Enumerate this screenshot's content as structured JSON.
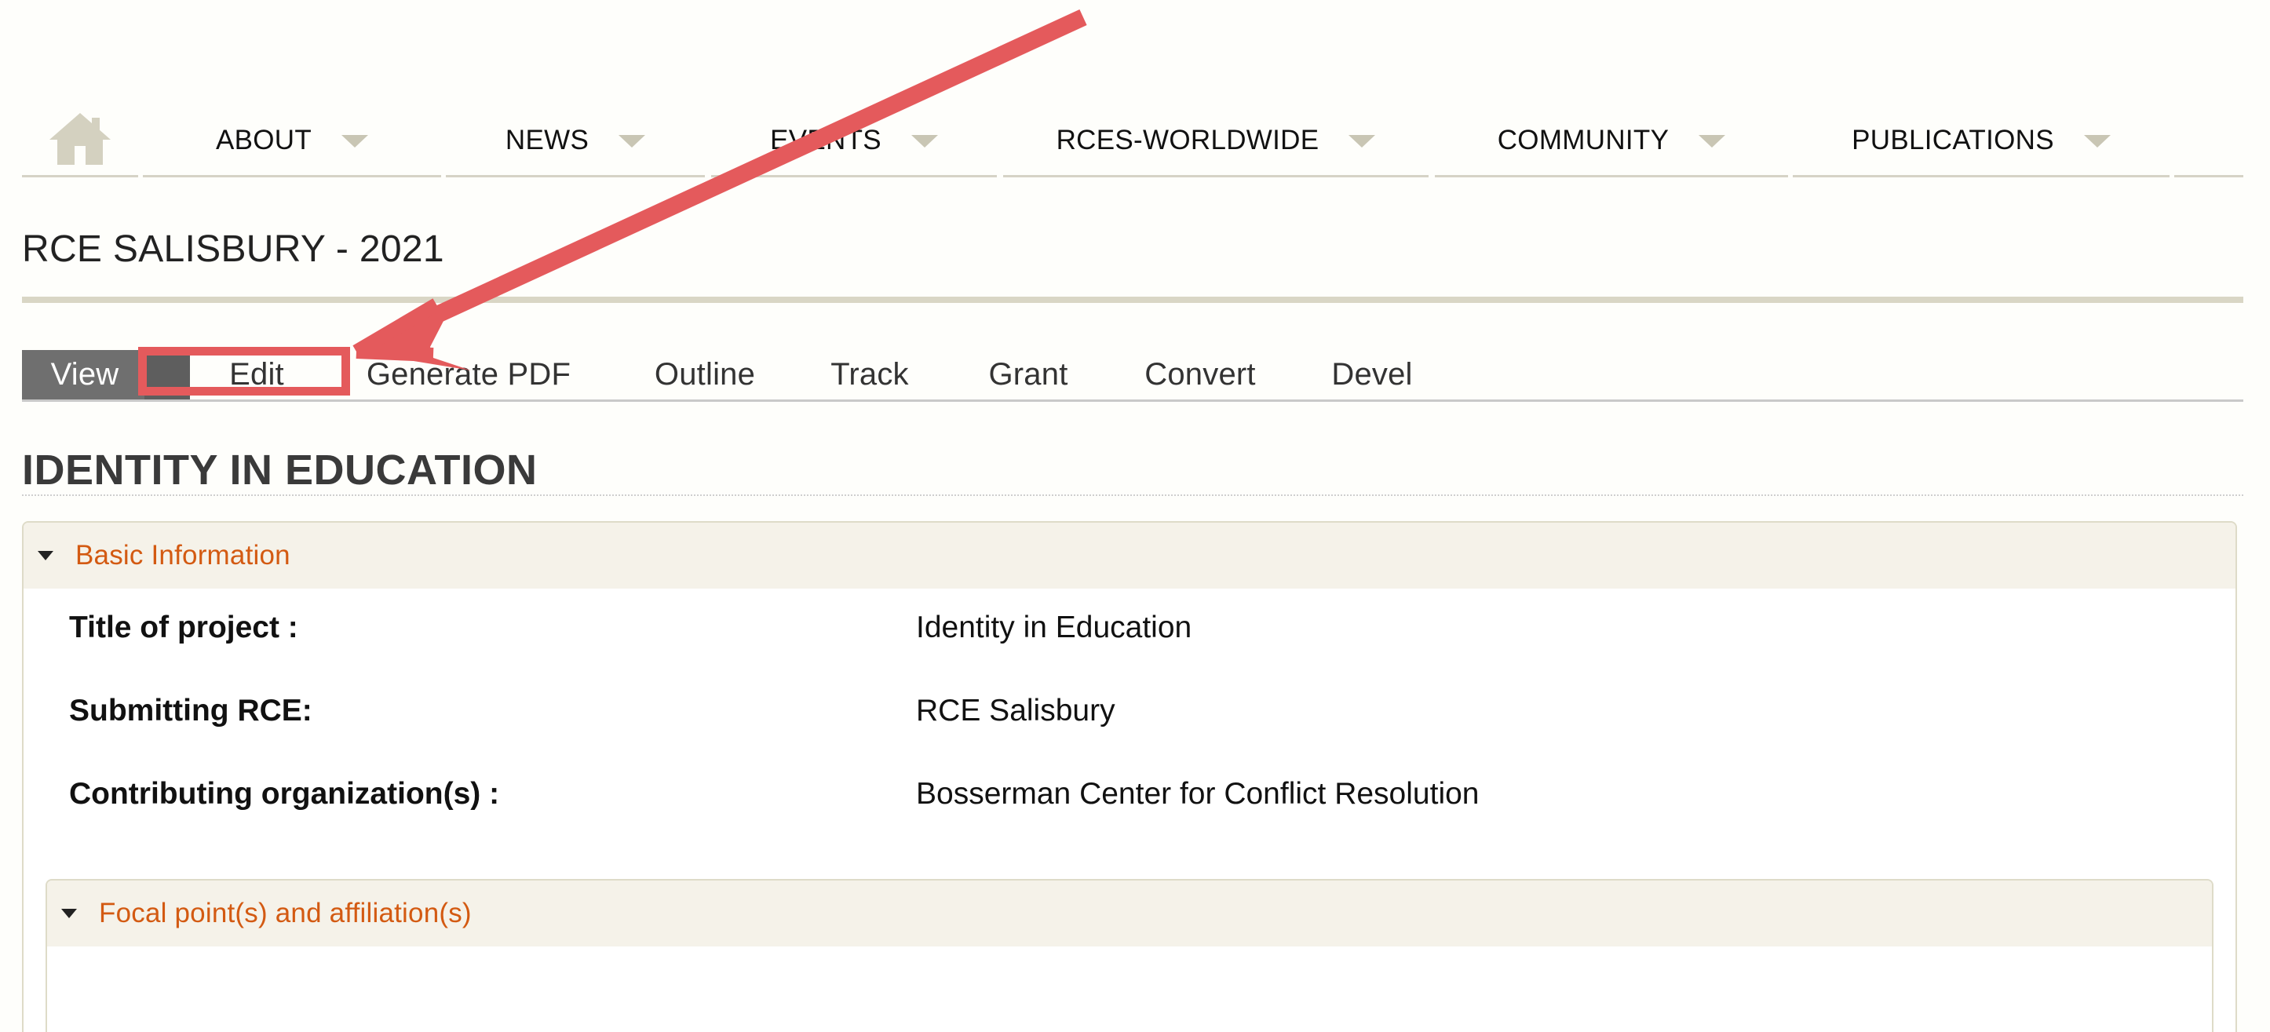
{
  "nav": {
    "home_icon": "home-icon",
    "items": [
      {
        "label": "ABOUT"
      },
      {
        "label": "NEWS"
      },
      {
        "label": "EVENTS"
      },
      {
        "label": "RCES-WORLDWIDE"
      },
      {
        "label": "COMMUNITY"
      },
      {
        "label": "PUBLICATIONS"
      }
    ],
    "caret_icon": "chevron-down-icon"
  },
  "page": {
    "title": "RCE SALISBURY - 2021"
  },
  "tabs": [
    {
      "label": "View",
      "active": true
    },
    {
      "label": "Edit"
    },
    {
      "label": "Generate PDF"
    },
    {
      "label": "Outline"
    },
    {
      "label": "Track"
    },
    {
      "label": "Grant"
    },
    {
      "label": "Convert"
    },
    {
      "label": "Devel"
    }
  ],
  "node": {
    "title": "IDENTITY IN EDUCATION"
  },
  "basic_info": {
    "legend": "Basic Information",
    "fields": [
      {
        "label": "Title of project :",
        "value": "Identity in Education"
      },
      {
        "label": "Submitting RCE:",
        "value": "RCE Salisbury"
      },
      {
        "label": "Contributing organization(s) :",
        "value": "Bosserman Center for Conflict Resolution"
      }
    ]
  },
  "focal": {
    "legend": "Focal point(s) and affiliation(s)"
  },
  "colors": {
    "accent_orange": "#d35a12",
    "annotation_red": "#e45a5c",
    "nav_rule": "#d6d3c6",
    "active_tab": "#6f6f6f"
  }
}
